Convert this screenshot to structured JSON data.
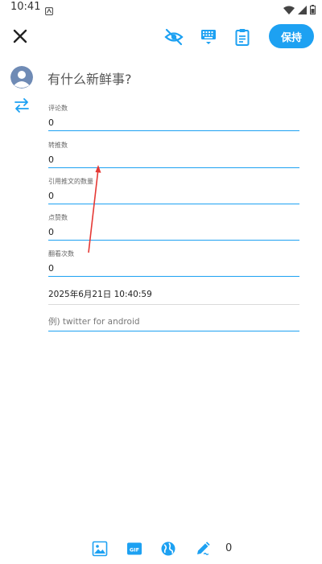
{
  "status_bar": {
    "time": "10:41",
    "battery_icon": "battery-icon",
    "wifi_icon": "wifi-icon",
    "signal_icon": "signal-icon"
  },
  "toolbar": {
    "close_icon": "close-icon",
    "hide_icon": "eye-off-icon",
    "keyboard_icon": "keyboard-icon",
    "clipboard_icon": "clipboard-icon",
    "save_label": "保持"
  },
  "compose": {
    "placeholder": "有什么新鲜事?"
  },
  "fields": [
    {
      "label": "评论数",
      "value": "0"
    },
    {
      "label": "转推数",
      "value": "0"
    },
    {
      "label": "引用推文的数量",
      "value": "0"
    },
    {
      "label": "点赞数",
      "value": "0"
    },
    {
      "label": "翻看次数",
      "value": "0"
    }
  ],
  "date_time": "2025年6月21日 10:40:59",
  "client_placeholder": "例) twitter for android",
  "bottom_bar": {
    "image_icon": "image-icon",
    "gif_icon": "gif-icon",
    "globe_icon": "globe-icon",
    "edit_icon": "pen-icon",
    "char_count": "0"
  },
  "colors": {
    "accent": "#1da1f2",
    "annotation": "#e53935"
  }
}
